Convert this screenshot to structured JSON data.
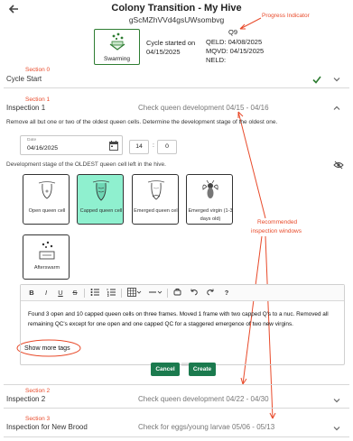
{
  "header": {
    "title": "Colony Transition - My Hive",
    "hive_id": "gScMZhVVd4gsUWsombvg",
    "stage_label": "Swarming",
    "stage_icon": "honeycomb-bees-icon",
    "cycle_started_label": "Cycle started on",
    "cycle_started_date": "04/15/2025",
    "phase_code": "Q9",
    "qeld": "QELD: 04/08/2025",
    "mqvd": "MQVD: 04/15/2025",
    "neld": "NELD:"
  },
  "annotations": {
    "progress_indicator": "Progress Indicator",
    "section0": "Section 0",
    "section1": "Section 1",
    "section2": "Section 2",
    "section3": "Section 3",
    "recommended_line1": "Recommended",
    "recommended_line2": "inspection windows",
    "accent_color": "#e84a2a"
  },
  "sections": {
    "cycle_start": {
      "title": "Cycle Start",
      "status": "complete",
      "check_color": "#2e7d32"
    },
    "inspection1": {
      "title": "Inspection 1",
      "window": "Check queen development 04/15 - 04/16"
    },
    "inspection2": {
      "title": "Inspection 2",
      "window": "Check queen development 04/22 - 04/30"
    },
    "inspection3": {
      "title": "Inspection for New Brood",
      "window": "Check for eggs/young larvae 05/06 - 05/13"
    }
  },
  "form": {
    "instructions": "Remove all but one or two of the oldest queen cells. Determine the development stage of the oldest one.",
    "date_caption": "Date",
    "date_value": "04/16/2025",
    "hour": "14",
    "minute": "0",
    "dev_stage_label": "Development stage of the OLDEST queen cell left in the hive.",
    "stages": [
      {
        "label": "Open queen cell",
        "icon": "open-queen-cell-icon",
        "selected": false
      },
      {
        "label": "Capped queen cell",
        "icon": "capped-queen-cell-icon",
        "selected": true
      },
      {
        "label": "Emerged queen cell",
        "icon": "emerged-queen-cell-icon",
        "selected": false
      },
      {
        "label": "Emerged virgin (1-3 days old)",
        "icon": "virgin-queen-icon",
        "selected": false
      },
      {
        "label": "Afterswarm",
        "icon": "afterswarm-icon",
        "selected": false
      }
    ],
    "selected_color": "#8ff0cf",
    "notes": "Found 3 open and 10 capped queen cells on three frames. Moved 1 frame with two capped Q's to a nuc. Removed all remaining QC's except for one open and one capped QC for a staggered emergence of two new virgins.",
    "toolbar": [
      "B",
      "I",
      "U",
      "S",
      "list",
      "numbered-list",
      "table",
      "color",
      "clear",
      "undo",
      "redo",
      "?"
    ],
    "more_tags_label": "Show more tags",
    "cancel_label": "Cancel",
    "create_label": "Create",
    "button_color": "#1b7a4e"
  }
}
